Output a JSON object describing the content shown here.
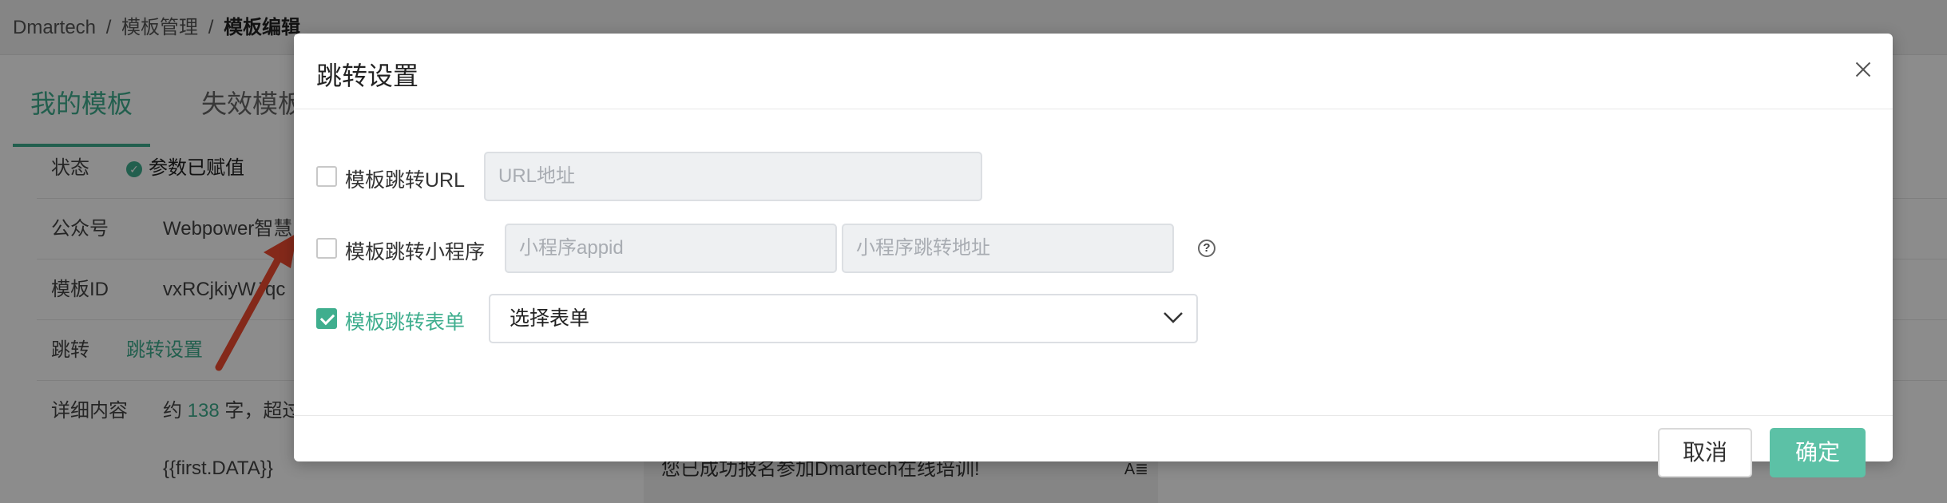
{
  "breadcrumb": {
    "root": "Dmartech",
    "sep": "/",
    "level1": "模板管理",
    "current": "模板编辑"
  },
  "tabs": [
    {
      "label": "我的模板"
    },
    {
      "label": "失效模板"
    }
  ],
  "info": {
    "status_label": "状态",
    "status_value": "参数已赋值",
    "account_label": "公众号",
    "account_value": "Webpower智慧",
    "template_id_label": "模板ID",
    "template_id_value": "vxRCjkiyWJqc",
    "jump_label": "跳转",
    "jump_link": "跳转设置",
    "detail_label": "详细内容",
    "detail_prefix": "约",
    "detail_count": "138",
    "detail_suffix": "字，超过",
    "first_data": "{{first.DATA}}"
  },
  "preview": {
    "text": "您已成功报名参加Dmartech在线培训!",
    "icon": "A≣"
  },
  "modal": {
    "title": "跳转设置",
    "url_option": {
      "label": "模板跳转URL",
      "checked": false,
      "placeholder": "URL地址"
    },
    "miniprogram_option": {
      "label": "模板跳转小程序",
      "checked": false,
      "appid_placeholder": "小程序appid",
      "path_placeholder": "小程序跳转地址",
      "help": "?"
    },
    "form_option": {
      "label": "模板跳转表单",
      "checked": true,
      "select_value": "选择表单"
    },
    "cancel_label": "取消",
    "confirm_label": "确定"
  },
  "colors": {
    "accent": "#3fae8e",
    "confirm": "#5cc1a6",
    "arrow": "#f04b30"
  }
}
